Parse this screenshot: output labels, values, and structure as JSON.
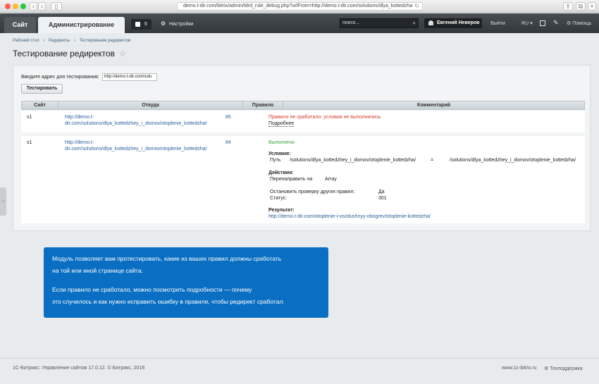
{
  "browser": {
    "url": "demo.t-dir.com/bitrix/admin/tdrd_rule_debug.php?urlFrom=http://demo.t-dir.com/solutions/dlya_kottedzha"
  },
  "admin_bar": {
    "tab_site": "Сайт",
    "tab_admin": "Администрирование",
    "notification_count": "5",
    "settings": "Настройки",
    "search_placeholder": "поиск...",
    "user": "Евгений Неверов",
    "logout": "Выйти",
    "lang": "RU",
    "help": "Помощь"
  },
  "breadcrumb": [
    "Рабочий стол",
    "Редиректы",
    "Тестирование редиректов"
  ],
  "page_title": "Тестирование редиректов",
  "form": {
    "label": "Введите адрес для тестирования:",
    "value": "http://demo.t-dir.com/solu",
    "button": "Тестировать"
  },
  "table": {
    "headers": [
      "Сайт",
      "Откуда",
      "Правило",
      "Комментарий"
    ],
    "rows": [
      {
        "site": "s1",
        "from_line1": "http://demo.t-",
        "from_line2": "dir.com/solutions/dlya_kottedzhey_i_domov/otoplenie_kottedzha/",
        "rule": "85",
        "status": "Правило не сработало: условия не выполнились",
        "details": "Подробнее"
      },
      {
        "site": "s1",
        "from_line1": "http://demo.t-",
        "from_line2": "dir.com/solutions/dlya_kottedzhey_i_domov/otoplenie_kottedzha/",
        "rule": "84",
        "status": "Выполнено",
        "conditions_label": "Условия:",
        "cond_field": "Путь",
        "cond_value": "/solutions/dlya_kottedzhey_i_domov/otoplenie_kottedzha/",
        "cond_op": "=",
        "cond_target": "/solutions/dlya_kottedzhey_i_domov/otoplenie_kottedzha/",
        "actions_label": "Действия:",
        "action_name": "Перенаправить на",
        "action_value": "Array",
        "stop_label": "Остановить проверку других правил:",
        "stop_value": "Да",
        "status_label": "Статус:",
        "status_value": "301",
        "result_label": "Результат:",
        "result_url": "http://demo.t-dir.com/otoplenie-i-vozdushnyy-obogrev/otoplenie-kottedzha/"
      }
    ]
  },
  "promo": {
    "line1": "Модуль позволяет вам протестировать, какие из ваших правил должны сработать",
    "line2": "на той или иной странице сайта.",
    "line3": "Если правило не сработало, можно посмотреть подробности — почему",
    "line4": "это случилось и как нужно исправить ошибку в правиле, чтобы редирект сработал."
  },
  "footer": {
    "copyright": "1С-Битрикс: Управление сайтом 17.0.12. © Битрикс, 2016",
    "link": "www.1c-bitrix.ru",
    "support": "Техподдержка"
  },
  "colors": {
    "promo": "#0a6fc2",
    "link": "#2c5f9e",
    "error": "#d23b2e",
    "success": "#39a23b"
  }
}
